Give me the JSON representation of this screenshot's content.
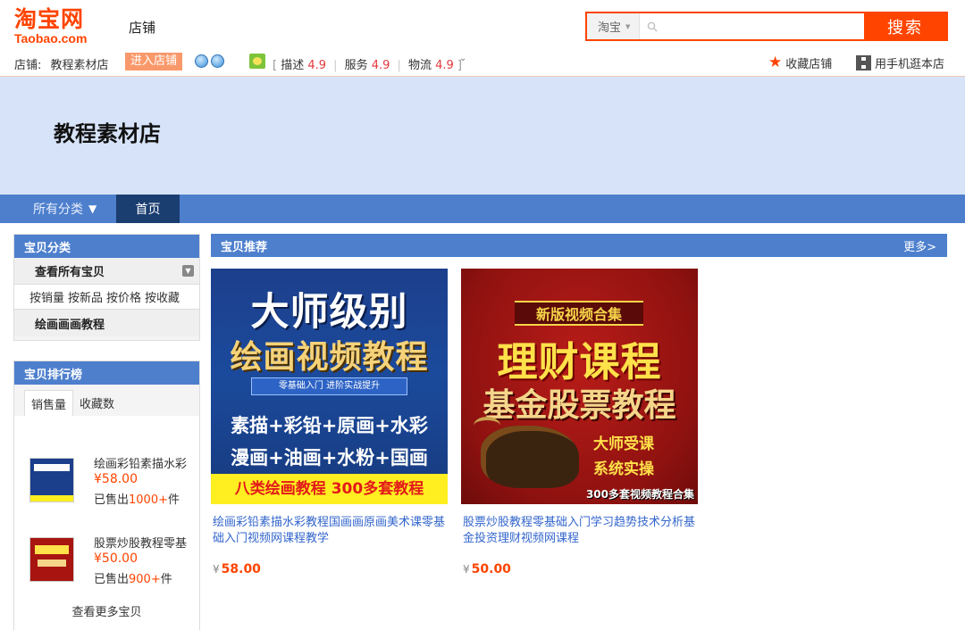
{
  "header": {
    "logo_cn": "淘宝网",
    "logo_en": "Taobao.com",
    "shop_tag": "店铺",
    "search": {
      "scope": "淘宝",
      "placeholder": "",
      "button": "搜索"
    }
  },
  "infobar": {
    "shop_label": "店铺:",
    "shop_name": "教程素材店",
    "enter_button": "进入店铺",
    "ratings": [
      {
        "label": "描述",
        "value": "4.9"
      },
      {
        "label": "服务",
        "value": "4.9"
      },
      {
        "label": "物流",
        "value": "4.9"
      }
    ],
    "favorite": "收藏店铺",
    "mobile": "用手机逛本店"
  },
  "banner": {
    "shop_title": "教程素材店"
  },
  "nav": {
    "all_categories": "所有分类",
    "home": "首页"
  },
  "sidebar": {
    "category_title": "宝贝分类",
    "view_all": "查看所有宝贝",
    "sort_links": [
      "按销量",
      "按新品",
      "按价格",
      "按收藏"
    ],
    "category_item": "绘画画画教程",
    "ranking_title": "宝贝排行榜",
    "ranking_tabs": [
      "销售量",
      "收藏数"
    ],
    "ranking_items": [
      {
        "title": "绘画彩铅素描水彩",
        "price": "¥58.00",
        "sold_prefix": "已售出",
        "sold_count": "1000+",
        "sold_suffix": "件"
      },
      {
        "title": "股票炒股教程零基",
        "price": "¥50.00",
        "sold_prefix": "已售出",
        "sold_count": "900+",
        "sold_suffix": "件"
      }
    ],
    "view_more": "查看更多宝贝"
  },
  "main": {
    "section_title": "宝贝推荐",
    "more": "更多>",
    "products": [
      {
        "title": "绘画彩铅素描水彩教程国画画原画美术课零基础入门视频网课程教学",
        "currency": "¥",
        "price": "58.00",
        "image_text": [
          "大师级别",
          "绘画视频教程",
          "零基础入门 进阶实战提升",
          "素描+彩铅+原画+水彩",
          "漫画+油画+水粉+国画",
          "八类绘画教程 300多套教程"
        ]
      },
      {
        "title": "股票炒股教程零基础入门学习趋势技术分析基金投资理财视频网课程",
        "currency": "¥",
        "price": "50.00",
        "image_text": [
          "新版视频合集",
          "理财课程",
          "基金股票教程",
          "大师受课",
          "系统实操",
          "300多套视频教程合集"
        ]
      }
    ]
  }
}
